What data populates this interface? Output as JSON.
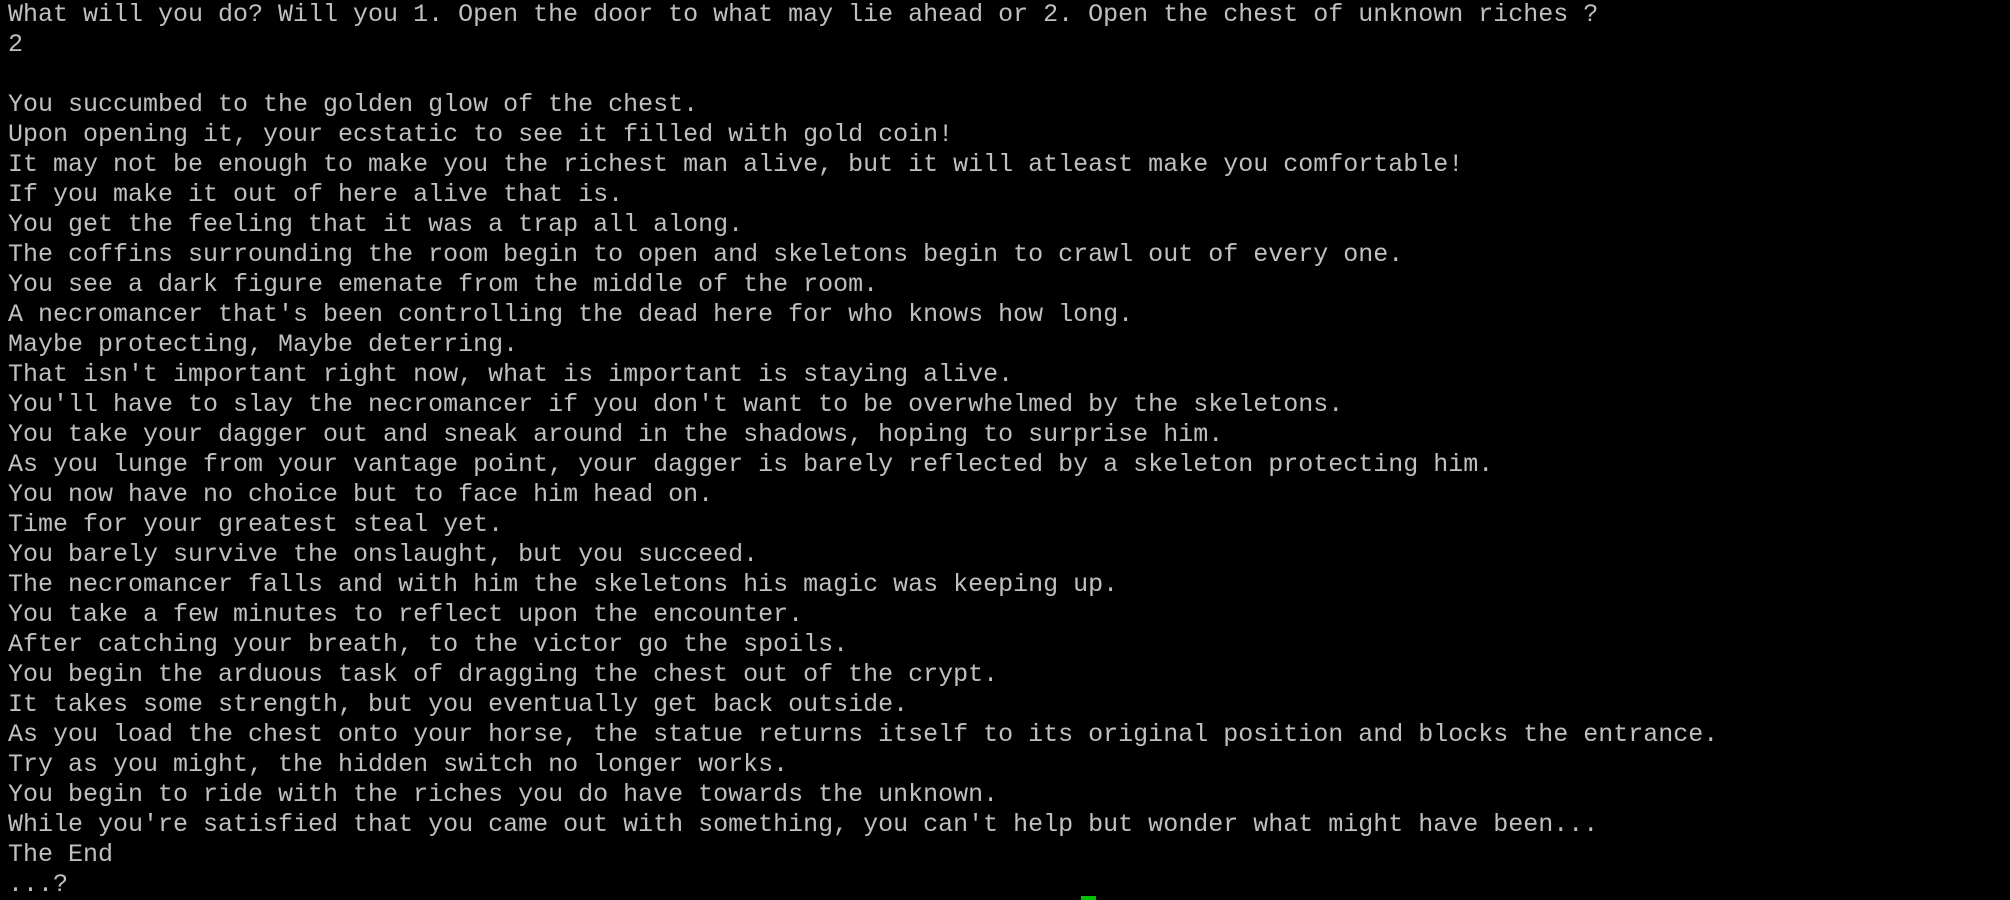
{
  "terminal": {
    "lines": [
      "What will you do? Will you 1. Open the door to what may lie ahead or 2. Open the chest of unknown riches ?",
      "2",
      "",
      "You succumbed to the golden glow of the chest.",
      "Upon opening it, your ecstatic to see it filled with gold coin!",
      "It may not be enough to make you the richest man alive, but it will atleast make you comfortable!",
      "If you make it out of here alive that is.",
      "You get the feeling that it was a trap all along.",
      "The coffins surrounding the room begin to open and skeletons begin to crawl out of every one.",
      "You see a dark figure emenate from the middle of the room.",
      "A necromancer that's been controlling the dead here for who knows how long.",
      "Maybe protecting, Maybe deterring.",
      "That isn't important right now, what is important is staying alive.",
      "You'll have to slay the necromancer if you don't want to be overwhelmed by the skeletons.",
      "You take your dagger out and sneak around in the shadows, hoping to surprise him.",
      "As you lunge from your vantage point, your dagger is barely reflected by a skeleton protecting him.",
      "You now have no choice but to face him head on.",
      "Time for your greatest steal yet.",
      "You barely survive the onslaught, but you succeed.",
      "The necromancer falls and with him the skeletons his magic was keeping up.",
      "You take a few minutes to reflect upon the encounter.",
      "After catching your breath, to the victor go the spoils.",
      "You begin the arduous task of dragging the chest out of the crypt.",
      "It takes some strength, but you eventually get back outside.",
      "As you load the chest onto your horse, the statue returns itself to its original position and blocks the entrance.",
      "Try as you might, the hidden switch no longer works.",
      "You begin to ride with the riches you do have towards the unknown.",
      "While you're satisfied that you came out with something, you can't help but wonder what might have been...",
      "The End",
      "...?"
    ],
    "colors": {
      "background": "#000000",
      "text": "#c0c0c0",
      "cursor": "#00c000"
    }
  }
}
